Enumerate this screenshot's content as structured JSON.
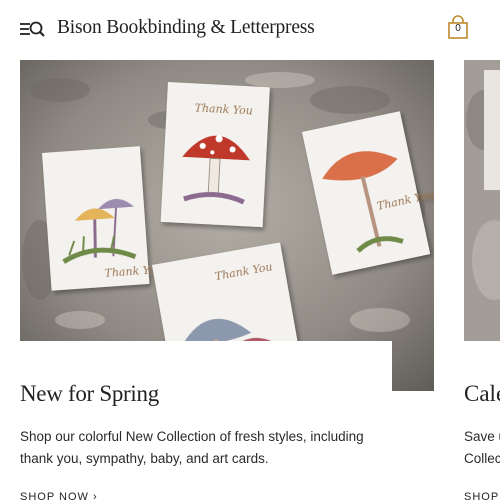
{
  "header": {
    "brand": "Bison Bookbinding & Letterpress",
    "menu_icon": "menu-search-icon",
    "cart_icon": "shopping-bag-icon",
    "cart_count": "0"
  },
  "cards": [
    {
      "title": "New for Spring",
      "description": "Shop our colorful New Collection of fresh styles, including thank you, sympathy, baby, and art cards.",
      "link_label": "SHOP NOW",
      "image_text": "Thank You"
    },
    {
      "title": "Cale",
      "description_line1": "Save u",
      "description_line2": "Collec",
      "link_label": "SHOP"
    }
  ],
  "colors": {
    "background": "#ffffff",
    "text": "#222222",
    "stone": "#8f8a83",
    "mushroom_red": "#c0392b",
    "mushroom_orange": "#d9704a",
    "mushroom_yellow": "#e3b45a",
    "mushroom_blue": "#8c98ad",
    "script_gold": "#9a7048"
  }
}
